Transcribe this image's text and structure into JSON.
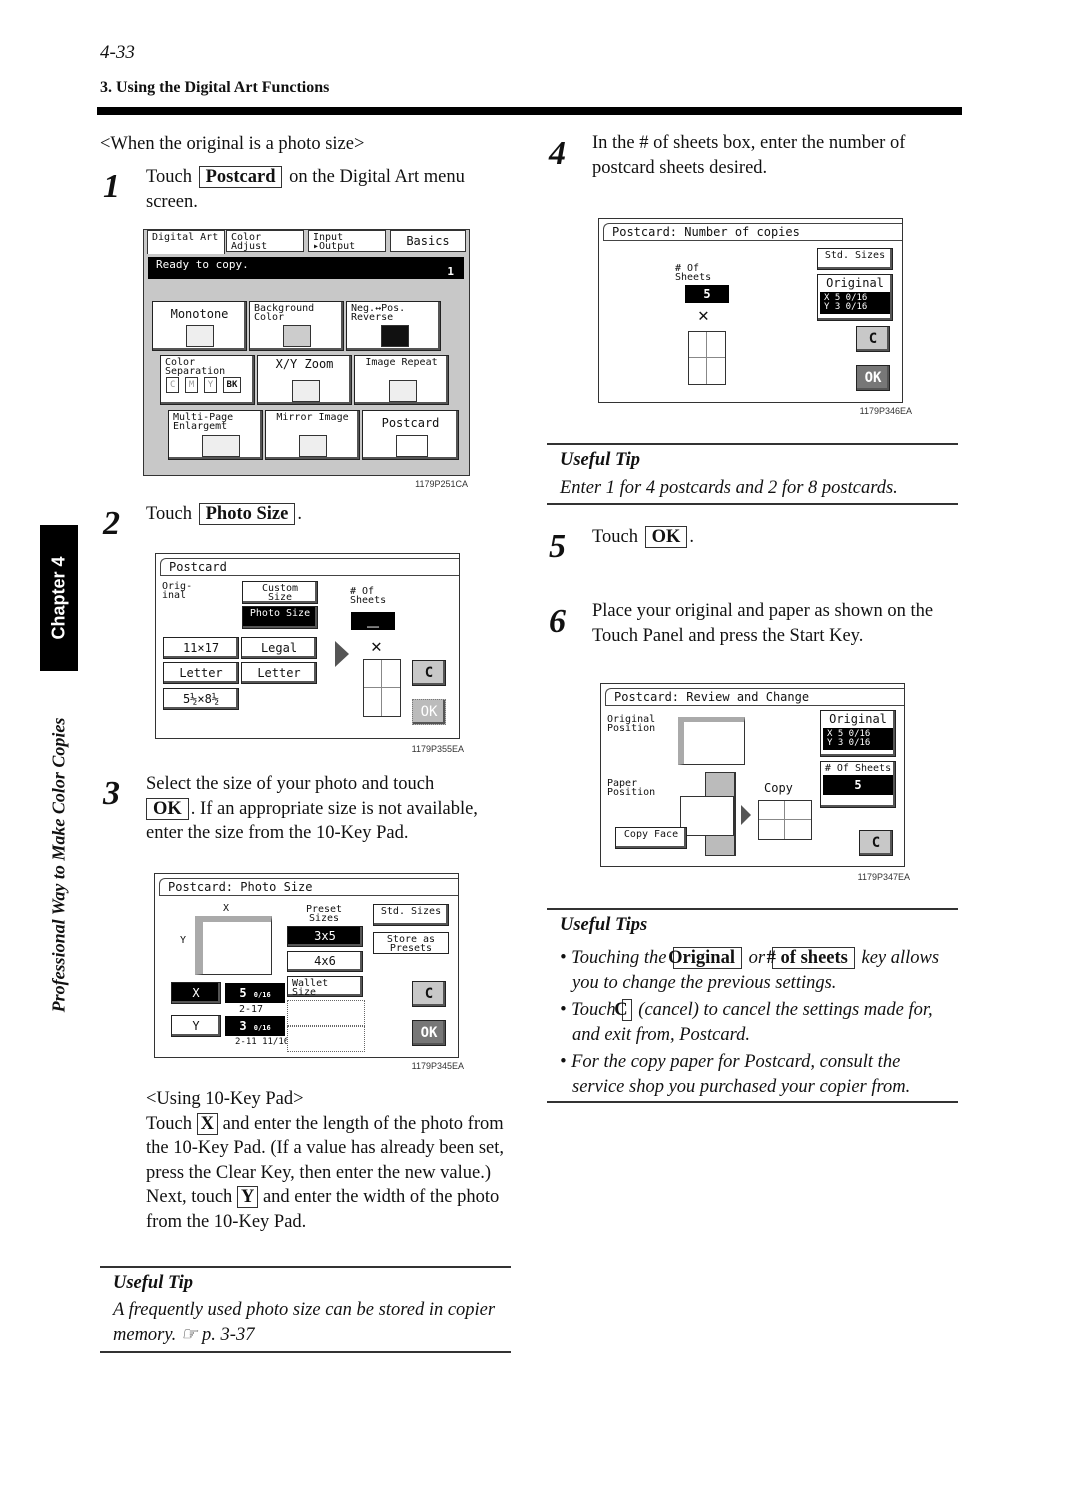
{
  "header": {
    "page_number": "4-33",
    "section_title": "3. Using the Digital Art Functions"
  },
  "sidebar": {
    "chapter_label": "Chapter 4",
    "book_title": "Professional Way to Make Color Copies"
  },
  "intro": "<When the original is a photo size>",
  "steps": [
    {
      "number": "1",
      "before": "Touch",
      "key": "Postcard",
      "after": "on the Digital Art menu screen."
    },
    {
      "number": "2",
      "before": "Touch",
      "key": "Photo Size",
      "after": "."
    },
    {
      "number": "3",
      "line1": "Select the size of your photo and touch",
      "key": "OK",
      "after": ". If an appropriate size is not available, enter the size from the 10-Key Pad."
    },
    {
      "number": "4",
      "text": "In the # of sheets box, enter the number of postcard sheets desired."
    },
    {
      "number": "5",
      "before": "Touch",
      "key": "OK",
      "after": "."
    },
    {
      "number": "6",
      "text": "Place your original and paper as shown on the Touch Panel and press the Start Key."
    }
  ],
  "keypad": {
    "heading": "<Using 10-Key Pad>",
    "x_before": "Touch",
    "x_key": "X",
    "x_after": "and enter the length of the photo from the 10-Key Pad. (If a value has already been set, press the Clear Key, then enter the new value.)",
    "y_before": "Next, touch",
    "y_key": "Y",
    "y_after": "and enter the width of the photo from the 10-Key Pad."
  },
  "tips": {
    "tip1_title": "Useful Tip",
    "tip1_text": "A frequently used photo size can be stored in copier memory. ☞ p. 3-37",
    "tip2_title": "Useful Tip",
    "tip2_text": "Enter 1 for 4 postcards and 2 for 8 postcards.",
    "tip3_title": "Useful Tips",
    "tip3_items": [
      {
        "before": "• Touching the",
        "key1": "Original",
        "mid": "or",
        "key2": "# of sheets",
        "after": "key allows you to change the previous settings."
      },
      {
        "before": "• Touch",
        "key1": "C",
        "after": "(cancel) to cancel the settings made for, and exit from, Postcard."
      },
      {
        "text": "• For the copy paper for Postcard, consult the service shop you purchased your copier from."
      }
    ]
  },
  "screen1": {
    "code": "1179P251CA",
    "tabs": [
      "Digital Art",
      "Color Adjust",
      "Input ▸Output",
      "Basics"
    ],
    "status": "Ready to copy.",
    "count": "1",
    "buttons": [
      "Monotone",
      "Background Color",
      "Neg.↔Pos. Reverse",
      "Color Separation",
      "X/Y Zoom",
      "Image Repeat",
      "Multi-Page Enlargemt",
      "Mirror Image",
      "Postcard"
    ],
    "sep_keys": [
      "C",
      "M",
      "Y",
      "BK"
    ]
  },
  "screen2": {
    "code": "1179P355EA",
    "title": "Postcard",
    "original_label": "Orig- inal",
    "custom_size": "Custom Size",
    "photo_size": "Photo Size",
    "sizes": [
      "11×17",
      "Legal",
      "Letter",
      "Letter",
      "5½×8½"
    ],
    "sheets_label": "# Of Sheets",
    "sheets_value": "__",
    "cancel": "C",
    "ok": "OK"
  },
  "screen3": {
    "code": "1179P345EA",
    "title": "Postcard: Photo Size",
    "x_label": "X",
    "y_label": "Y",
    "x_value": "5",
    "x_frac": "0/16",
    "x_range": "2-17",
    "y_value": "3",
    "y_frac": "0/16",
    "y_range": "2-11 11/16",
    "preset_label": "Preset Sizes",
    "presets": [
      "3x5",
      "4x6",
      "Wallet Size"
    ],
    "std_sizes": "Std. Sizes",
    "store_presets": "Store as Presets",
    "cancel": "C",
    "ok": "OK"
  },
  "screen4": {
    "code": "1179P346EA",
    "title": "Postcard: Number of copies",
    "sheets_label": "# Of Sheets",
    "sheets_value": "5",
    "std_sizes": "Std. Sizes",
    "original_label": "Original",
    "original_x": "X  5 0/16",
    "original_y": "Y  3 0/16",
    "cancel": "C",
    "ok": "OK"
  },
  "screen5": {
    "code": "1179P347EA",
    "title": "Postcard: Review and Change",
    "original_position": "Original Position",
    "paper_position": "Paper Position",
    "copy_face": "Copy Face",
    "copy_label": "Copy",
    "original_label": "Original",
    "original_x": "X  5 0/16",
    "original_y": "Y  3 0/16",
    "sheets_label": "# Of Sheets",
    "sheets_value": "5",
    "cancel": "C"
  }
}
